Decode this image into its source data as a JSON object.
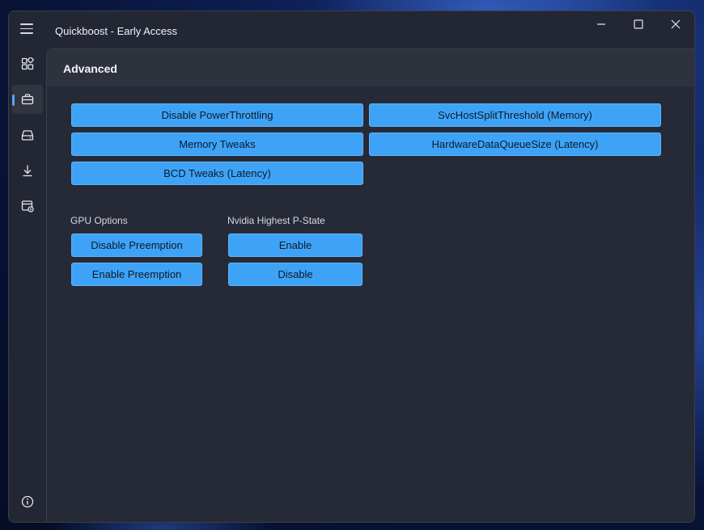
{
  "app": {
    "title": "Quickboost - Early Access"
  },
  "window_controls": {
    "minimize_icon": "minimize-icon",
    "maximize_icon": "maximize-icon",
    "close_icon": "close-icon"
  },
  "sidebar": {
    "items": [
      {
        "name": "apps",
        "icon": "apps-icon",
        "selected": false
      },
      {
        "name": "toolbox",
        "icon": "toolbox-icon",
        "selected": true
      },
      {
        "name": "drive",
        "icon": "drive-icon",
        "selected": false
      },
      {
        "name": "download",
        "icon": "download-icon",
        "selected": false
      },
      {
        "name": "settings-window",
        "icon": "window-settings-icon",
        "selected": false
      }
    ],
    "info_icon": "info-icon"
  },
  "page": {
    "title": "Advanced"
  },
  "tweaks": {
    "disable_power_throttling": "Disable PowerThrottling",
    "svchost_split_threshold": "SvcHostSplitThreshold (Memory)",
    "memory_tweaks": "Memory Tweaks",
    "hardware_data_queue_size": "HardwareDataQueueSize (Latency)",
    "bcd_tweaks": "BCD Tweaks (Latency)"
  },
  "gpu_options": {
    "label": "GPU Options",
    "disable_preemption": "Disable Preemption",
    "enable_preemption": "Enable Preemption"
  },
  "nvidia_pstate": {
    "label": "Nvidia Highest P-State",
    "enable": "Enable",
    "disable": "Disable"
  },
  "colors": {
    "accent": "#3ea3f6",
    "window_bg": "#232733",
    "content_bg": "#262a36",
    "header_bg": "#2e323d"
  }
}
